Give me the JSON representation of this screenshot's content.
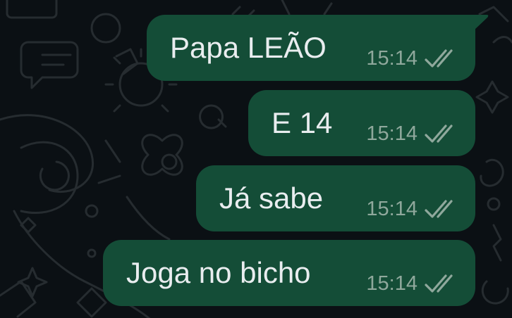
{
  "chat": {
    "messages": [
      {
        "text": "Papa LEÃO",
        "time": "15:14",
        "status_icon": "double-check-icon",
        "status": "delivered"
      },
      {
        "text": "E 14",
        "time": "15:14",
        "status_icon": "double-check-icon",
        "status": "delivered"
      },
      {
        "text": "Já sabe",
        "time": "15:14",
        "status_icon": "double-check-icon",
        "status": "delivered"
      },
      {
        "text": "Joga no bicho",
        "time": "15:14",
        "status_icon": "double-check-icon",
        "status": "delivered"
      }
    ]
  },
  "colors": {
    "chat_background": "#0b1014",
    "doodle_stroke": "#262c30",
    "outgoing_bubble": "#144d37",
    "message_text": "#e9edef",
    "meta_text": "#8fa89c"
  }
}
